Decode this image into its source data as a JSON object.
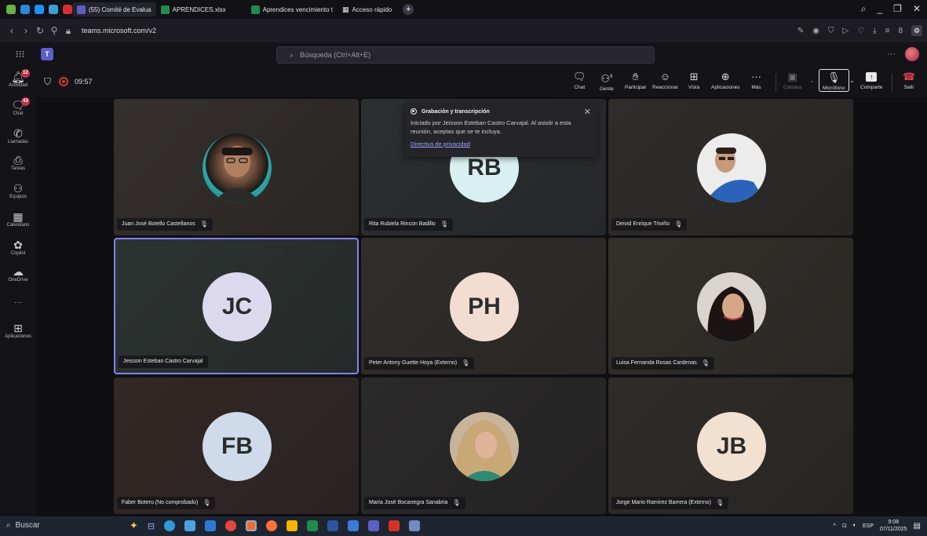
{
  "browser": {
    "tabs": [
      {
        "label": "(55) Comité de Evalua",
        "active": true
      },
      {
        "label": "APRENDICES.xlsx",
        "active": false
      },
      {
        "label": "Aprendices vencimiento t",
        "active": false
      },
      {
        "label": "Acceso rápido",
        "active": false
      }
    ],
    "new_tab_label": "+",
    "url": "teams.microsoft.com/v2",
    "profile_initial": "8"
  },
  "teams": {
    "search_placeholder": "Búsqueda (Ctrl+Alt+E)",
    "more_label": "···",
    "rail": [
      {
        "label": "Actividad",
        "badge": "12",
        "icon": "bell-icon"
      },
      {
        "label": "Chat",
        "badge": "43",
        "icon": "chat-icon"
      },
      {
        "label": "Llamadas",
        "badge": "",
        "icon": "phone-icon"
      },
      {
        "label": "Tareas",
        "badge": "",
        "icon": "tasks-icon"
      },
      {
        "label": "Equipos",
        "badge": "",
        "icon": "teams-icon"
      },
      {
        "label": "Calendario",
        "badge": "",
        "icon": "calendar-icon"
      },
      {
        "label": "Copilot",
        "badge": "",
        "icon": "copilot-icon"
      },
      {
        "label": "OneDrive",
        "badge": "",
        "icon": "cloud-icon"
      },
      {
        "label": "···",
        "badge": "",
        "icon": "more-icon"
      },
      {
        "label": "Aplicaciones",
        "badge": "",
        "icon": "plus-icon"
      }
    ]
  },
  "meeting": {
    "timer": "09:57",
    "toolbar": {
      "chat": "Chat",
      "people": "Gente",
      "people_count": "9",
      "raise": "Participar",
      "react": "Reaccionar",
      "view": "Vista",
      "apps": "Aplicaciones",
      "more": "Más",
      "camera": "Cámara",
      "mic": "Micrófono",
      "share": "Comparte",
      "leave": "Salir"
    },
    "recording_popup": {
      "title": "Grabación y transcripción",
      "body": "Iniciado por Jeisson Esteban Castro Carvajal. Al asistir a esta reunión, aceptas que se te incluya.",
      "link": "Directiva de privacidad"
    },
    "participants": [
      {
        "name": "Juan José Botello Castellanos",
        "initials": "",
        "photo": true,
        "muted": true
      },
      {
        "name": "Rita Rubiela Rincon Badillo",
        "initials": "RB",
        "photo": false,
        "muted": true,
        "color": "#d9f0f2"
      },
      {
        "name": "Deivid Enrique Triviño",
        "initials": "",
        "photo": true,
        "muted": true
      },
      {
        "name": "Jeisson Esteban Castro Carvajal",
        "initials": "JC",
        "photo": false,
        "muted": false,
        "color": "#dcd8ee"
      },
      {
        "name": "Peter Antony Guette Hoya (Externo)",
        "initials": "PH",
        "photo": false,
        "muted": true,
        "color": "#f3ddd3"
      },
      {
        "name": "Luisa Fernanda Rosas Cardenas",
        "initials": "",
        "photo": true,
        "muted": true
      },
      {
        "name": "Faber Botero (No comprobado)",
        "initials": "FB",
        "photo": false,
        "muted": true,
        "color": "#cfdbea"
      },
      {
        "name": "María José Bocanegra Sanabria",
        "initials": "",
        "photo": true,
        "muted": true
      },
      {
        "name": "Jorge Mario Ramirez Barrera (Externo)",
        "initials": "JB",
        "photo": false,
        "muted": true,
        "color": "#f2e0d0"
      }
    ]
  },
  "taskbar": {
    "search_label": "Buscar",
    "lang": "ESP",
    "time": "9:08",
    "date": "07/11/2025"
  }
}
